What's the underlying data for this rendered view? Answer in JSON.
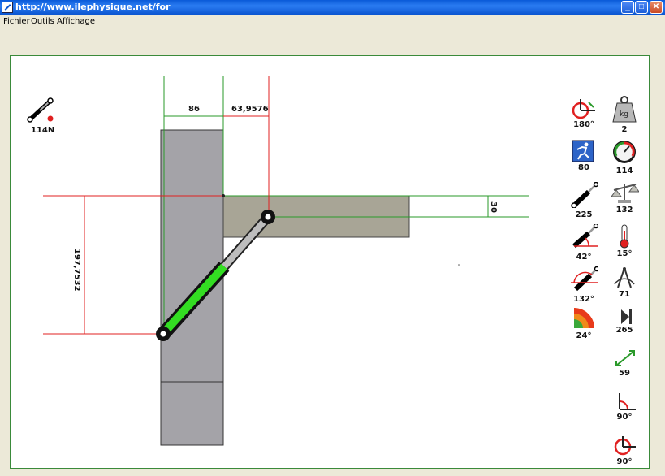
{
  "window": {
    "title": "http://www.ilephysique.net/for"
  },
  "menu": {
    "items": [
      "Fichier",
      "Outils",
      "Affichage"
    ]
  },
  "diagram": {
    "force_indicator": "114N",
    "dim_width_top": "86",
    "dim_offset_top": "63,9576",
    "dim_height_left": "197,7532",
    "dim_beam_height": "30"
  },
  "toolbox": {
    "left_column": [
      {
        "icon": "rotation-angle-icon",
        "value": "180°"
      },
      {
        "icon": "runner-icon",
        "value": "80"
      },
      {
        "icon": "cylinder-icon",
        "value": "225"
      },
      {
        "icon": "cylinder-angle-icon",
        "value": "42°"
      },
      {
        "icon": "cylinder-angle-obtuse-icon",
        "value": "132°"
      },
      {
        "icon": "fan-sector-icon",
        "value": "24°"
      }
    ],
    "right_column": [
      {
        "icon": "weight-kg-icon",
        "value": "2"
      },
      {
        "icon": "gauge-icon",
        "value": "114"
      },
      {
        "icon": "balance-scale-icon",
        "value": "132"
      },
      {
        "icon": "thermometer-icon",
        "value": "15°"
      },
      {
        "icon": "compass-icon",
        "value": "71"
      },
      {
        "icon": "step-forward-icon",
        "value": "265"
      },
      {
        "icon": "double-arrow-icon",
        "value": "59"
      },
      {
        "icon": "right-angle-icon",
        "value": "90°"
      },
      {
        "icon": "right-angle-rotate-icon",
        "value": "90°"
      }
    ]
  },
  "colors": {
    "grey_block": "#a4a3a8",
    "beam": "#a8a596",
    "cylinder_body": "#33dd22",
    "dim_red": "#e02020",
    "dim_green": "#2a9a2a",
    "title_blue": "#0a55d0"
  }
}
